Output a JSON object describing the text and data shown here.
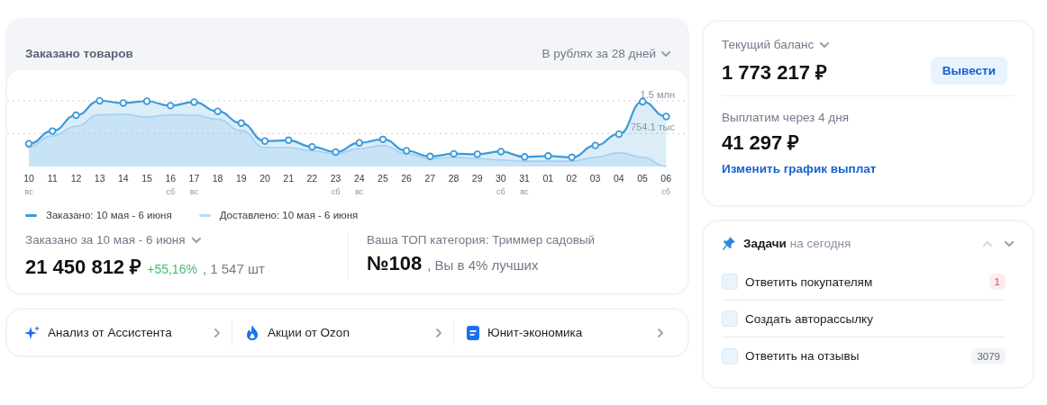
{
  "orders_card": {
    "title": "Заказано товаров",
    "period_select": "В рублях за 28 дней",
    "chart": {
      "x_labels": [
        "10\nвс",
        "11",
        "12",
        "13",
        "14",
        "15",
        "16\nсб",
        "17\nвс",
        "18",
        "19",
        "20",
        "21",
        "22",
        "23\nсб",
        "24\nвс",
        "25",
        "26",
        "27",
        "28",
        "29",
        "30\nсб",
        "31\nвс",
        "01",
        "02",
        "03",
        "04",
        "05",
        "06\nсб"
      ],
      "gridline_labels": [
        "1.5 млн",
        "754.1 тыс"
      ],
      "legend": [
        {
          "label": "Заказано: 10 мая - 6 июня",
          "color": "#3d9ad9"
        },
        {
          "label": "Доставлено: 10 мая - 6 июня",
          "color": "#b9ddf5"
        }
      ]
    },
    "summary": {
      "label": "Заказано за 10 мая - 6 июня",
      "amount": "21 450 812 ₽",
      "change": "+55,16%",
      "count": ", 1 547 шт"
    },
    "category": {
      "label": "Ваша ТОП категория: Триммер садовый",
      "rank": "№108",
      "note": ", Вы в 4% лучших"
    }
  },
  "links": [
    {
      "kind": "sparkle",
      "label": "Анализ от Ассистента"
    },
    {
      "kind": "fire",
      "label": "Акции от Ozon"
    },
    {
      "kind": "document",
      "label": "Юнит-экономика"
    }
  ],
  "balance_card": {
    "label": "Текущий баланс",
    "amount": "1 773 217 ₽",
    "button": "Вывести",
    "payout_label": "Выплатим через 4 дня",
    "payout_amount": "41 297 ₽",
    "payout_link": "Изменить график выплат"
  },
  "tasks_card": {
    "title": "Задачи",
    "subtitle": "на сегодня",
    "tasks": [
      {
        "label": "Ответить покупателям",
        "checked": false,
        "badge": {
          "text": "1",
          "kind": "alert"
        }
      },
      {
        "label": "Создать авторассылку",
        "checked": false
      },
      {
        "label": "Ответить на отзывы",
        "checked": false,
        "badge": {
          "text": "3079",
          "kind": "neutral"
        }
      }
    ]
  }
}
